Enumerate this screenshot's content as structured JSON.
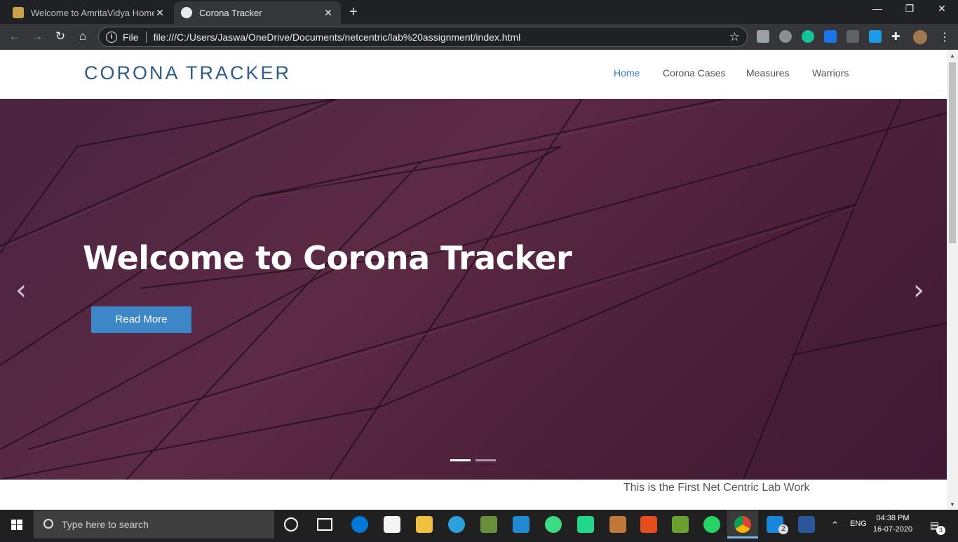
{
  "browser": {
    "tabs": [
      {
        "title": "Welcome to AmritaVidya Home",
        "active": false
      },
      {
        "title": "Corona Tracker",
        "active": true
      }
    ],
    "newtab": "+",
    "address": {
      "scheme_label": "File",
      "url": "file:///C:/Users/Jaswa/OneDrive/Documents/netcentric/lab%20assignment/index.html"
    }
  },
  "site": {
    "brand": "CORONA TRACKER",
    "nav": [
      "Home",
      "Corona Cases",
      "Measures",
      "Warriors"
    ],
    "hero": {
      "title": "Welcome to Corona Tracker",
      "button": "Read More",
      "slides": 2,
      "active_slide": 1
    },
    "footer_text": "This is the First Net Centric Lab Work"
  },
  "taskbar": {
    "search_placeholder": "Type here to search",
    "language": "ENG",
    "time": "04:38 PM",
    "date": "16-07-2020",
    "mail_badge": "2",
    "notification_badge": "3"
  },
  "colors": {
    "brand": "#2f5b8a",
    "nav_active": "#3a7bc0",
    "button": "#3d87c8",
    "hero_bg": "#5c2a45"
  }
}
